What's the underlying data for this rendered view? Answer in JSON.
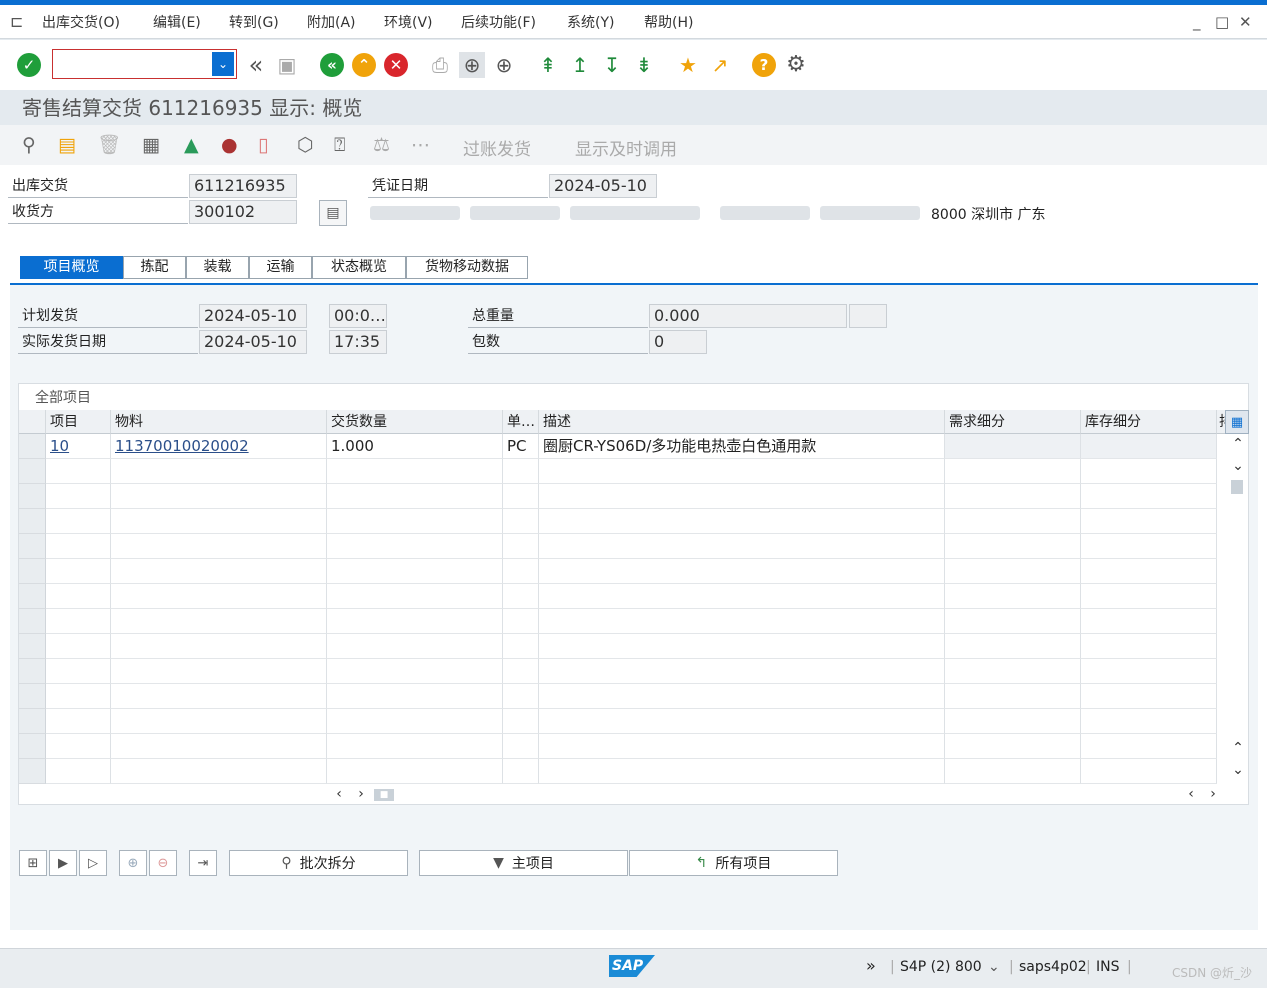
{
  "menu": {
    "items": [
      "出库交货(O)",
      "编辑(E)",
      "转到(G)",
      "附加(A)",
      "环境(V)",
      "后续功能(F)",
      "系统(Y)",
      "帮助(H)"
    ]
  },
  "window_controls": {
    "minimize": "_",
    "maximize": "□",
    "close": "✕"
  },
  "toolbar": {
    "command_value": ""
  },
  "title": "寄售结算交货 611216935 显示: 概览",
  "app_toolbar": {
    "post_goods_issue": "过账发货",
    "show_on_time": "显示及时调用"
  },
  "header": {
    "delivery_label": "出库交货",
    "delivery_value": "611216935",
    "ship_to_label": "收货方",
    "ship_to_value": "300102",
    "doc_date_label": "凭证日期",
    "doc_date_value": "2024-05-10",
    "address_tail": "8000 深圳市 广东"
  },
  "tabs": [
    "项目概览",
    "拣配",
    "装载",
    "运输",
    "状态概览",
    "货物移动数据"
  ],
  "overview": {
    "planned_gi_label": "计划发货",
    "planned_gi_date": "2024-05-10",
    "planned_gi_time": "00:0…",
    "actual_gi_label": "实际发货日期",
    "actual_gi_date": "2024-05-10",
    "actual_gi_time": "17:35",
    "total_weight_label": "总重量",
    "total_weight_value": "0.000",
    "packages_label": "包数",
    "packages_value": "0"
  },
  "table": {
    "group_title": "全部项目",
    "columns": [
      "项目",
      "物料",
      "交货数量",
      "单…",
      "描述",
      "需求细分",
      "库存细分",
      "排"
    ],
    "rows": [
      {
        "item": "10",
        "material": "11370010020002",
        "qty": "1.000",
        "unit": "PC",
        "desc": "圈厨CR-YS06D/多功能电热壶白色通用款",
        "req": "",
        "stock": ""
      }
    ]
  },
  "bottom_buttons": {
    "batch_split": "批次拆分",
    "main_items": "主项目",
    "all_items": "所有项目"
  },
  "status": {
    "system": "S4P (2) 800",
    "server": "saps4p02",
    "mode": "INS",
    "watermark": "CSDN @炘_沙"
  },
  "colors": {
    "accent": "#0a6ed1",
    "ok_green": "#1f9e3a",
    "cancel_red": "#d9262c",
    "warn_orange": "#f0a30a"
  }
}
